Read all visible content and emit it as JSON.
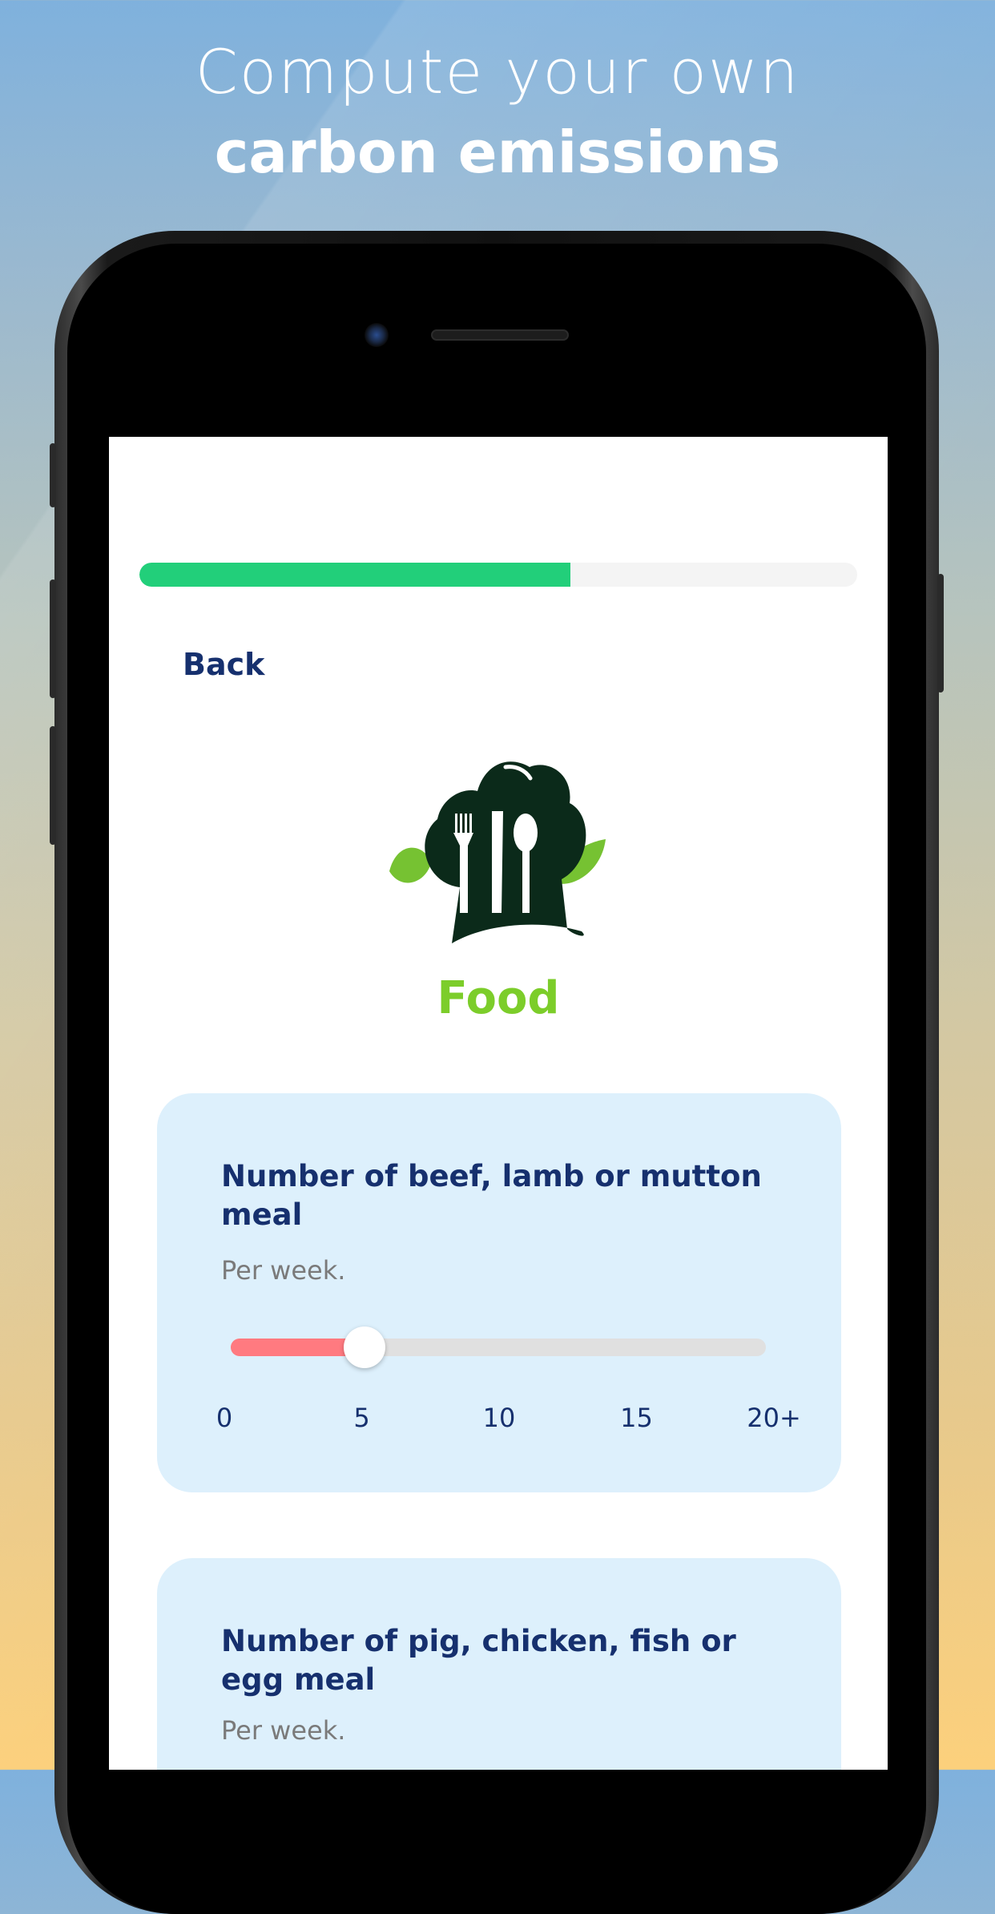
{
  "headline": {
    "line1": "Compute your own",
    "line2": "carbon emissions"
  },
  "colors": {
    "progress": "#22cf7a",
    "title": "#16306e",
    "category": "#7ccd2a",
    "card": "#ddf0fc",
    "slider_fill": "#ff7a80"
  },
  "progress": {
    "fraction": 0.6
  },
  "nav": {
    "back_label": "Back"
  },
  "category": {
    "icon": "chef-hat-cutlery-icon",
    "label": "Food"
  },
  "questions": [
    {
      "title": "Number of beef, lamb or mutton meal",
      "subtitle": "Per week.",
      "slider": {
        "value": 5,
        "min": 0,
        "max": 20,
        "tick_labels": [
          "0",
          "5",
          "10",
          "15",
          "20+"
        ]
      }
    },
    {
      "title": "Number of pig, chicken, fish or egg meal",
      "subtitle": "Per week."
    }
  ]
}
